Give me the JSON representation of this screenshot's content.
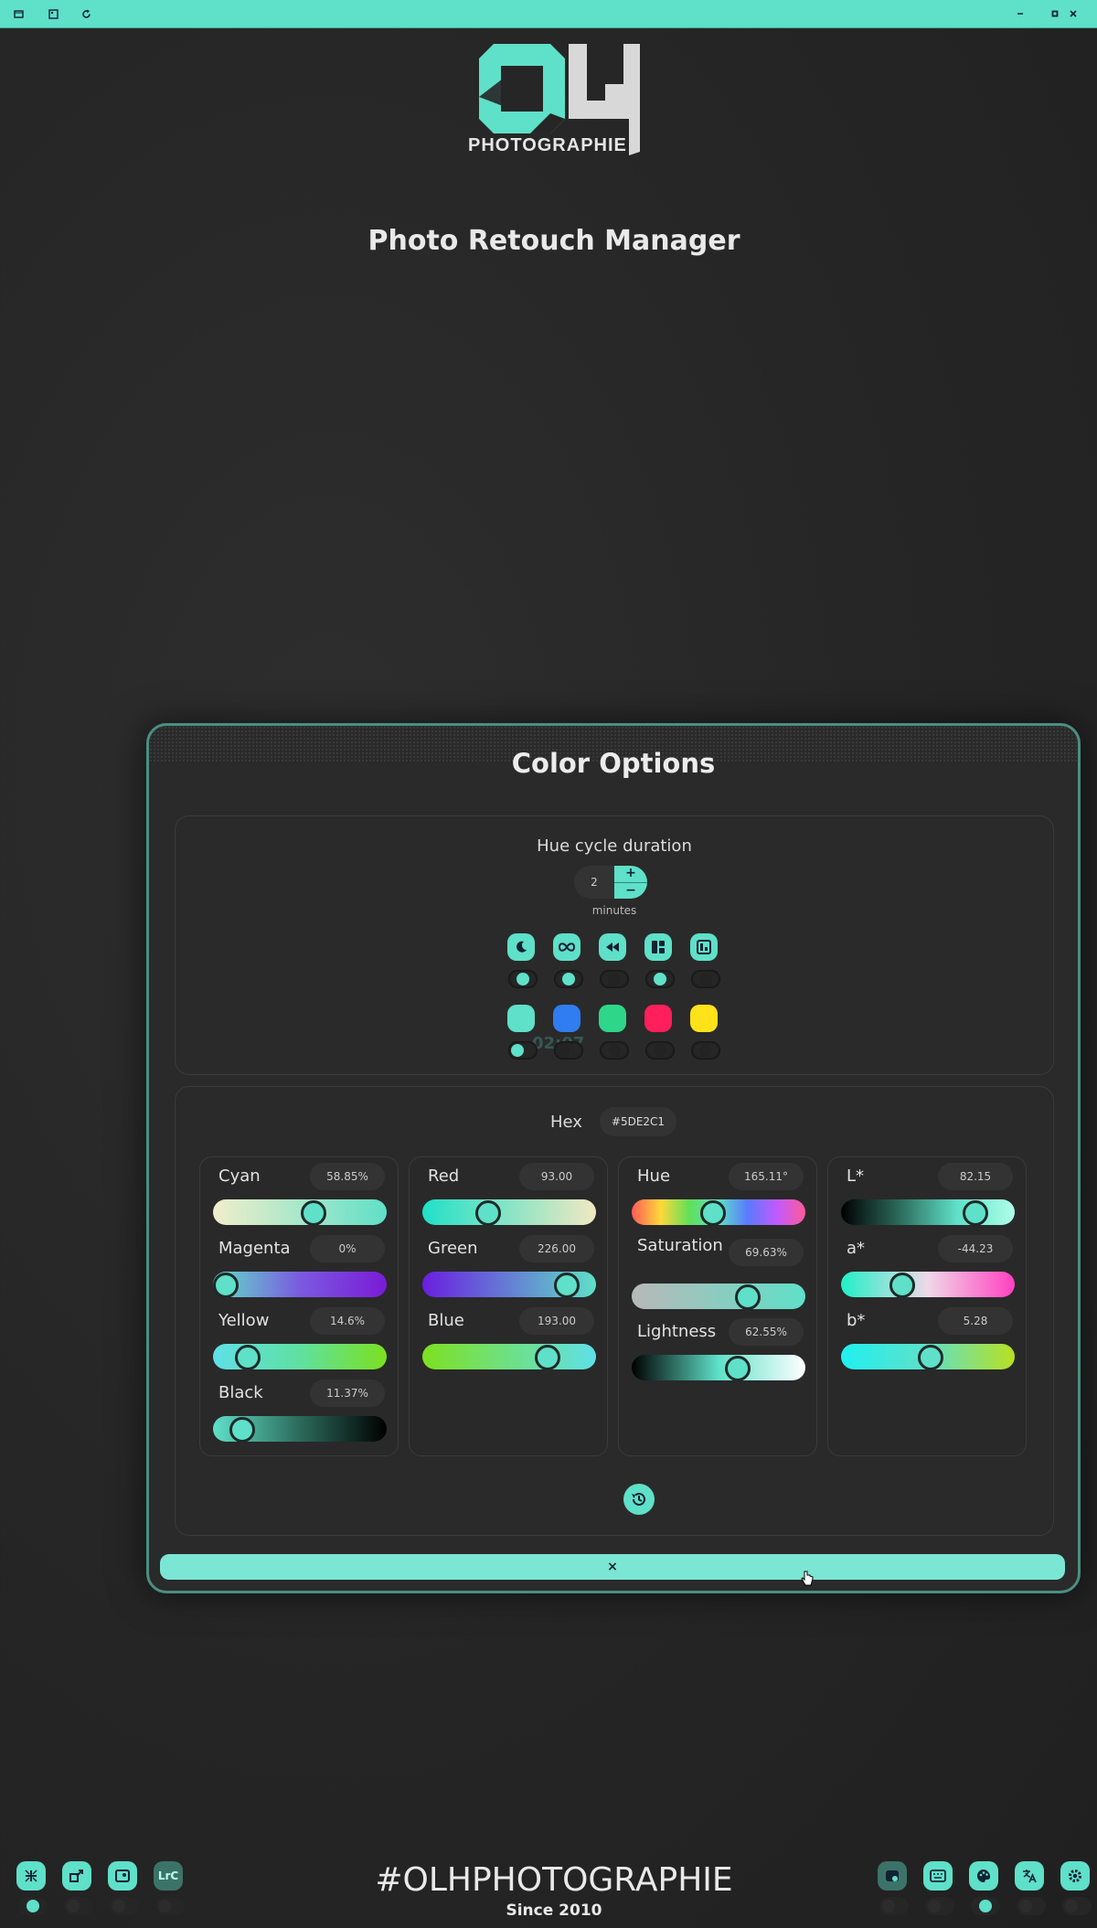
{
  "window": {
    "min_icon": "minimize-icon",
    "max_icon": "maximize-icon",
    "close_icon": "close-icon"
  },
  "brand": {
    "logo_text": "PHOTOGRAPHIE",
    "logo_mark": "OL",
    "accent": "#5fe0c8"
  },
  "page_title": "Photo Retouch Manager",
  "color_options": {
    "title": "Color Options",
    "hue_cycle": {
      "label": "Hue cycle duration",
      "value": "2",
      "unit": "minutes",
      "plus": "+",
      "minus": "−"
    },
    "mode_toggles": [
      {
        "icon": "moon-icon",
        "on": true
      },
      {
        "icon": "infinity-icon",
        "on": true
      },
      {
        "icon": "rewind-icon",
        "on": false
      },
      {
        "icon": "layout-icon",
        "on": true
      },
      {
        "icon": "layout-alt-icon",
        "on": false
      }
    ],
    "swatches": [
      {
        "color": "#5fe0c8",
        "on": true
      },
      {
        "color": "#2f7df0",
        "on": false
      },
      {
        "color": "#2ed68a",
        "on": false
      },
      {
        "color": "#ff1f5a",
        "on": false
      },
      {
        "color": "#ffe21a",
        "on": false
      }
    ],
    "clock_text": "02:07",
    "hex": {
      "label": "Hex",
      "value": "#5DE2C1"
    },
    "cmyk": [
      {
        "label": "Cyan",
        "value": "58.85%",
        "level": 0.59
      },
      {
        "label": "Magenta",
        "value": "0%",
        "level": 0.0
      },
      {
        "label": "Yellow",
        "value": "14.6%",
        "level": 0.15
      },
      {
        "label": "Black",
        "value": "11.37%",
        "level": 0.11
      }
    ],
    "rgb": [
      {
        "label": "Red",
        "value": "93.00",
        "level": 0.36
      },
      {
        "label": "Green",
        "value": "226.00",
        "level": 0.89
      },
      {
        "label": "Blue",
        "value": "193.00",
        "level": 0.76
      }
    ],
    "hsl": [
      {
        "label": "Hue",
        "value": "165.11°",
        "level": 0.46
      },
      {
        "label": "Saturation",
        "value": "69.63%",
        "level": 0.7
      },
      {
        "label": "Lightness",
        "value": "62.55%",
        "level": 0.63
      }
    ],
    "lab": [
      {
        "label": "L*",
        "value": "82.15",
        "level": 0.82
      },
      {
        "label": "a*",
        "value": "-44.23",
        "level": 0.33
      },
      {
        "label": "b*",
        "value": "5.28",
        "level": 0.52
      }
    ],
    "reset_icon": "history-icon",
    "close_label": "×"
  },
  "footer": {
    "tag": "#OLHPHOTOGRAPHIE",
    "since": "Since 2010"
  },
  "dock_left": [
    {
      "icon": "collapse-icon",
      "text": "",
      "on": true
    },
    {
      "icon": "expand-icon",
      "text": "",
      "on": false
    },
    {
      "icon": "photo-icon",
      "text": "",
      "on": false
    },
    {
      "icon": "lightroom-icon",
      "text": "LrC",
      "on": false
    }
  ],
  "dock_right": [
    {
      "icon": "photo-edit-icon",
      "on": false
    },
    {
      "icon": "keyboard-icon",
      "on": false
    },
    {
      "icon": "palette-icon",
      "on": true
    },
    {
      "icon": "translate-icon",
      "on": false
    },
    {
      "icon": "settings-icon",
      "on": false
    }
  ]
}
